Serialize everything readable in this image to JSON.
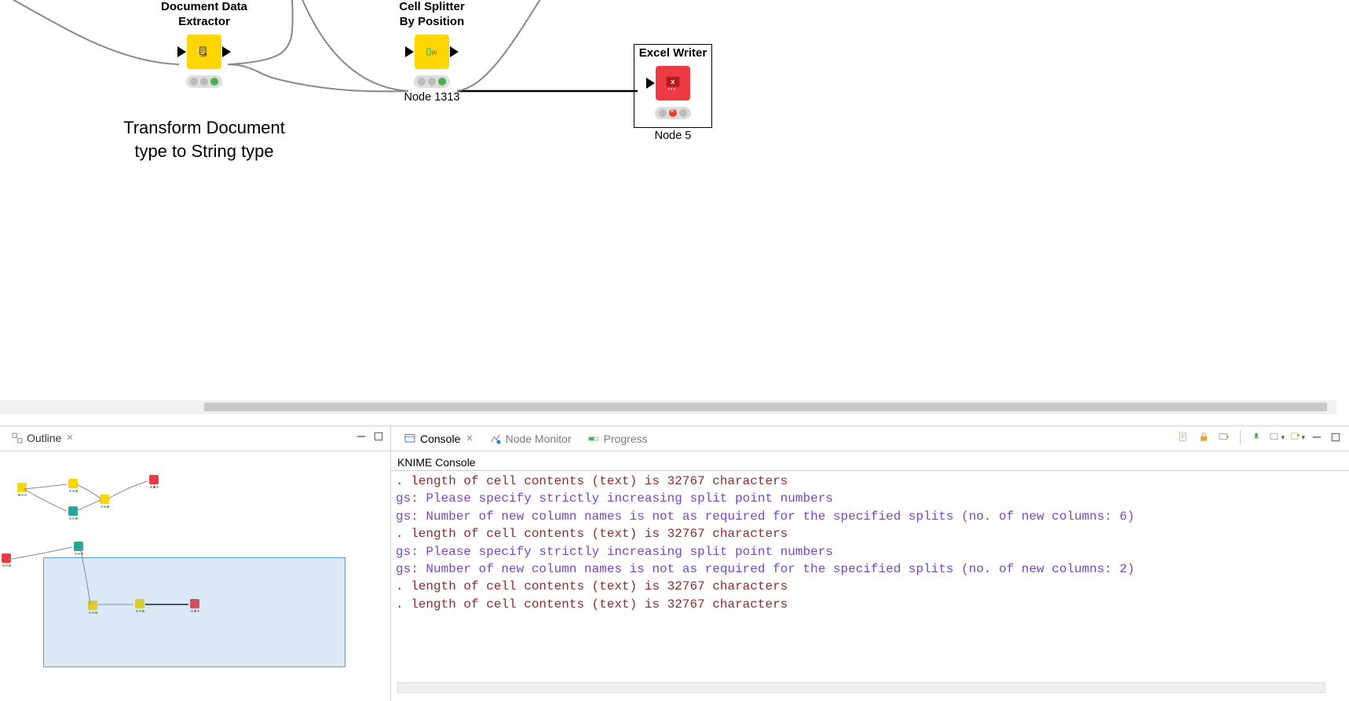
{
  "nodes": {
    "doc_extractor": {
      "title": "Document Data\nExtractor",
      "annotation": "Transform\nDocument type\nto String type"
    },
    "cell_splitter": {
      "title": "Cell Splitter\nBy Position",
      "sub": "Node 1313"
    },
    "excel_writer": {
      "title": "Excel Writer",
      "sub": "Node 5"
    }
  },
  "outline": {
    "tab": "Outline"
  },
  "console_panel": {
    "tabs": {
      "console": "Console",
      "node_monitor": "Node Monitor",
      "progress": "Progress"
    },
    "title": "KNIME Console",
    "lines": [
      {
        "cls": "brown",
        "text": ". length of cell contents (text) is 32767 characters"
      },
      {
        "cls": "purple",
        "text": "gs: Please specify strictly increasing split point numbers"
      },
      {
        "cls": "purple",
        "text": "gs: Number of new column names is not as required for the specified splits (no. of new columns: 6)"
      },
      {
        "cls": "brown",
        "text": ". length of cell contents (text) is 32767 characters"
      },
      {
        "cls": "purple",
        "text": "gs: Please specify strictly increasing split point numbers"
      },
      {
        "cls": "purple",
        "text": "gs: Number of new column names is not as required for the specified splits (no. of new columns: 2)"
      },
      {
        "cls": "brown",
        "text": ". length of cell contents (text) is 32767 characters"
      },
      {
        "cls": "brown",
        "text": ". length of cell contents (text) is 32767 characters"
      }
    ]
  }
}
